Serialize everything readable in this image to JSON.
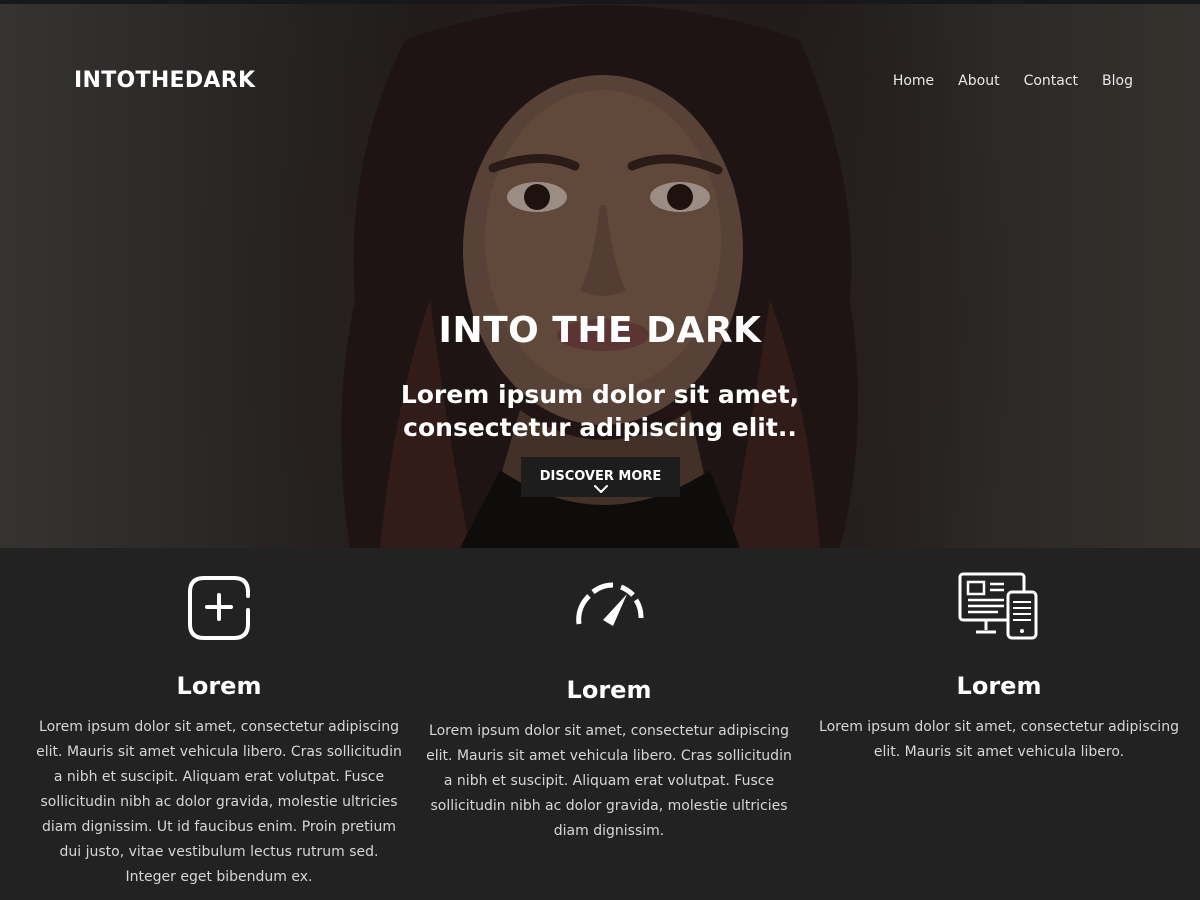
{
  "header": {
    "logo": "INTOTHEDARK",
    "nav": [
      {
        "label": "Home"
      },
      {
        "label": "About"
      },
      {
        "label": "Contact"
      },
      {
        "label": "Blog"
      }
    ]
  },
  "hero": {
    "title": "INTO THE DARK",
    "subtitle": "Lorem ipsum dolor sit amet, consectetur adipiscing elit..",
    "button_label": "DISCOVER MORE"
  },
  "features": [
    {
      "icon": "add-square-icon",
      "heading": "Lorem",
      "text": "Lorem ipsum dolor sit amet, consectetur adipiscing elit. Mauris sit amet vehicula libero. Cras sollicitudin a nibh et suscipit. Aliquam erat volutpat. Fusce sollicitudin nibh ac dolor gravida, molestie ultricies diam dignissim. Ut id faucibus enim. Proin pretium dui justo, vitae vestibulum lectus rutrum sed. Integer eget bibendum ex."
    },
    {
      "icon": "speedometer-icon",
      "heading": "Lorem",
      "text": "Lorem ipsum dolor sit amet, consectetur adipiscing elit. Mauris sit amet vehicula libero. Cras sollicitudin a nibh et suscipit. Aliquam erat volutpat. Fusce sollicitudin nibh ac dolor gravida, molestie ultricies diam dignissim."
    },
    {
      "icon": "responsive-devices-icon",
      "heading": "Lorem",
      "text": "Lorem ipsum dolor sit amet, consectetur adipiscing elit. Mauris sit amet vehicula libero."
    }
  ],
  "colors": {
    "hero_overlay": "#000000",
    "section_background": "#222222",
    "button_background": "#1d1d1d",
    "text": "#ffffff"
  }
}
